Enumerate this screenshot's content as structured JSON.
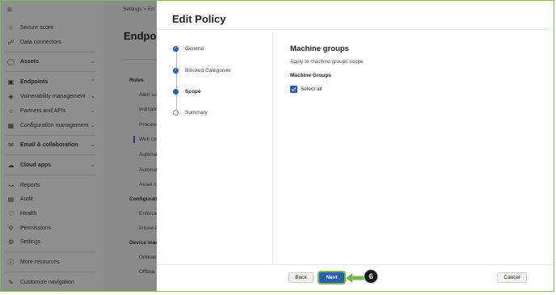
{
  "nav": {
    "menu_icon": "hamburger-icon",
    "items": [
      {
        "label": "Secure score",
        "icon": "trophy-icon"
      },
      {
        "label": "Data connectors",
        "icon": "connector-icon"
      },
      {
        "label": "Assets",
        "icon": "assets-icon"
      },
      {
        "label": "Endpoints",
        "icon": "endpoints-icon"
      },
      {
        "label": "Vulnerability management",
        "icon": "shield-icon"
      },
      {
        "label": "Partners and APIs",
        "icon": "partners-icon"
      },
      {
        "label": "Configuration management",
        "icon": "config-icon"
      },
      {
        "label": "Email & collaboration",
        "icon": "mail-icon"
      },
      {
        "label": "Cloud apps",
        "icon": "cloud-icon"
      },
      {
        "label": "Reports",
        "icon": "reports-icon"
      },
      {
        "label": "Audit",
        "icon": "audit-icon"
      },
      {
        "label": "Health",
        "icon": "heart-icon"
      },
      {
        "label": "Permissions",
        "icon": "key-icon"
      },
      {
        "label": "Settings",
        "icon": "gear-icon"
      },
      {
        "label": "More resources",
        "icon": "info-icon"
      },
      {
        "label": "Customize navigation",
        "icon": "pencil-icon"
      }
    ]
  },
  "background_page": {
    "breadcrumb": "Settings  >  En",
    "title": "Endpoi",
    "section_rules": "Rules",
    "rules_items": [
      "Alert su",
      "Indicato",
      "Process",
      "Web co",
      "Automa",
      "Automa",
      "Asset ru"
    ],
    "section_config": "Configuratio",
    "config_items": [
      "Enforce",
      "Intune P"
    ],
    "section_device": "Device mana",
    "device_items": [
      "Onboar",
      "Offboa"
    ]
  },
  "dialog": {
    "title": "Edit Policy",
    "steps": [
      {
        "label": "General",
        "state": "done"
      },
      {
        "label": "Blocked Categories",
        "state": "done"
      },
      {
        "label": "Scope",
        "state": "current"
      },
      {
        "label": "Summary",
        "state": "todo"
      }
    ],
    "content": {
      "heading": "Machine groups",
      "description": "Apply to machine groups scope",
      "group_label": "Machine Groups",
      "checkbox_label": "Select all",
      "checkbox_checked": true
    },
    "buttons": {
      "back": "Back",
      "next": "Next",
      "cancel": "Cancel"
    },
    "callout_number": "6"
  },
  "colors": {
    "accent": "#2b5fb0",
    "highlight": "#7ab648",
    "overlay": "#8c8c8c"
  }
}
